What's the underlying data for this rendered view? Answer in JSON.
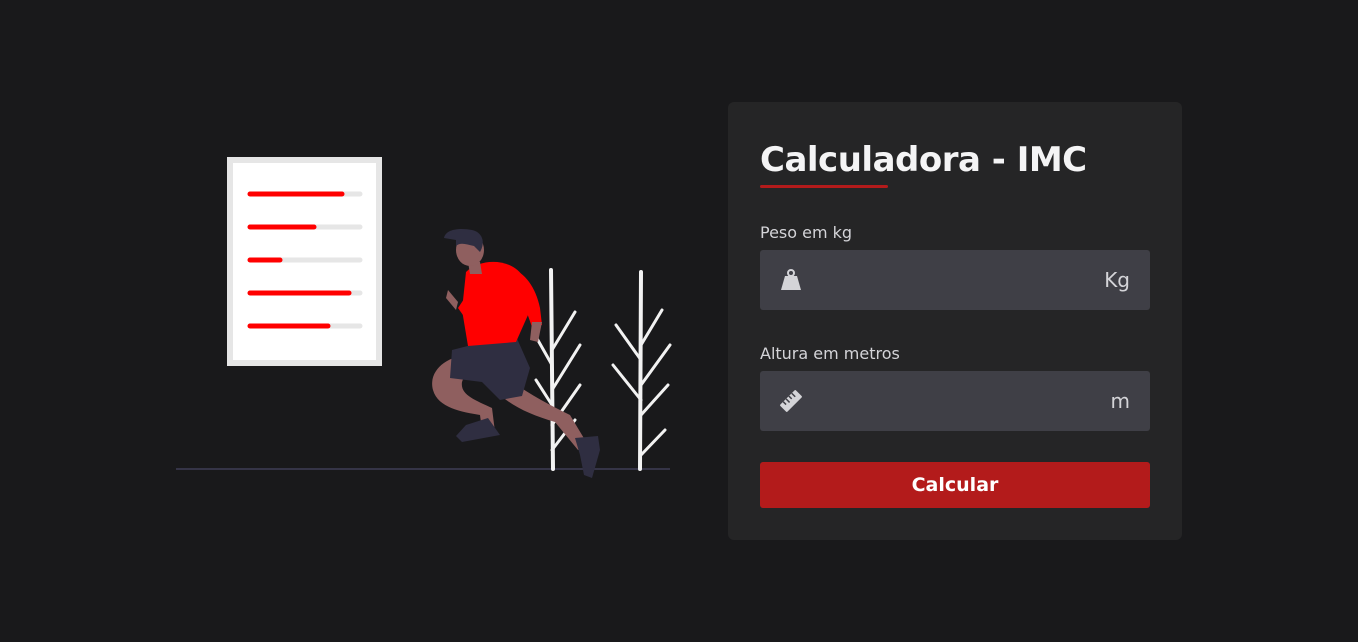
{
  "card": {
    "title": "Calculadora - IMC"
  },
  "weight": {
    "label": "Peso em kg",
    "value": "",
    "placeholder": "",
    "unit": "Kg",
    "icon": "weight-icon"
  },
  "height": {
    "label": "Altura em metros",
    "value": "",
    "placeholder": "",
    "unit": "m",
    "icon": "ruler-icon"
  },
  "button": {
    "label": "Calcular"
  },
  "colors": {
    "background": "#19191b",
    "card": "#252526",
    "input": "#3f3f46",
    "accent": "#b31b1b",
    "illustration_red": "#ff0000"
  }
}
